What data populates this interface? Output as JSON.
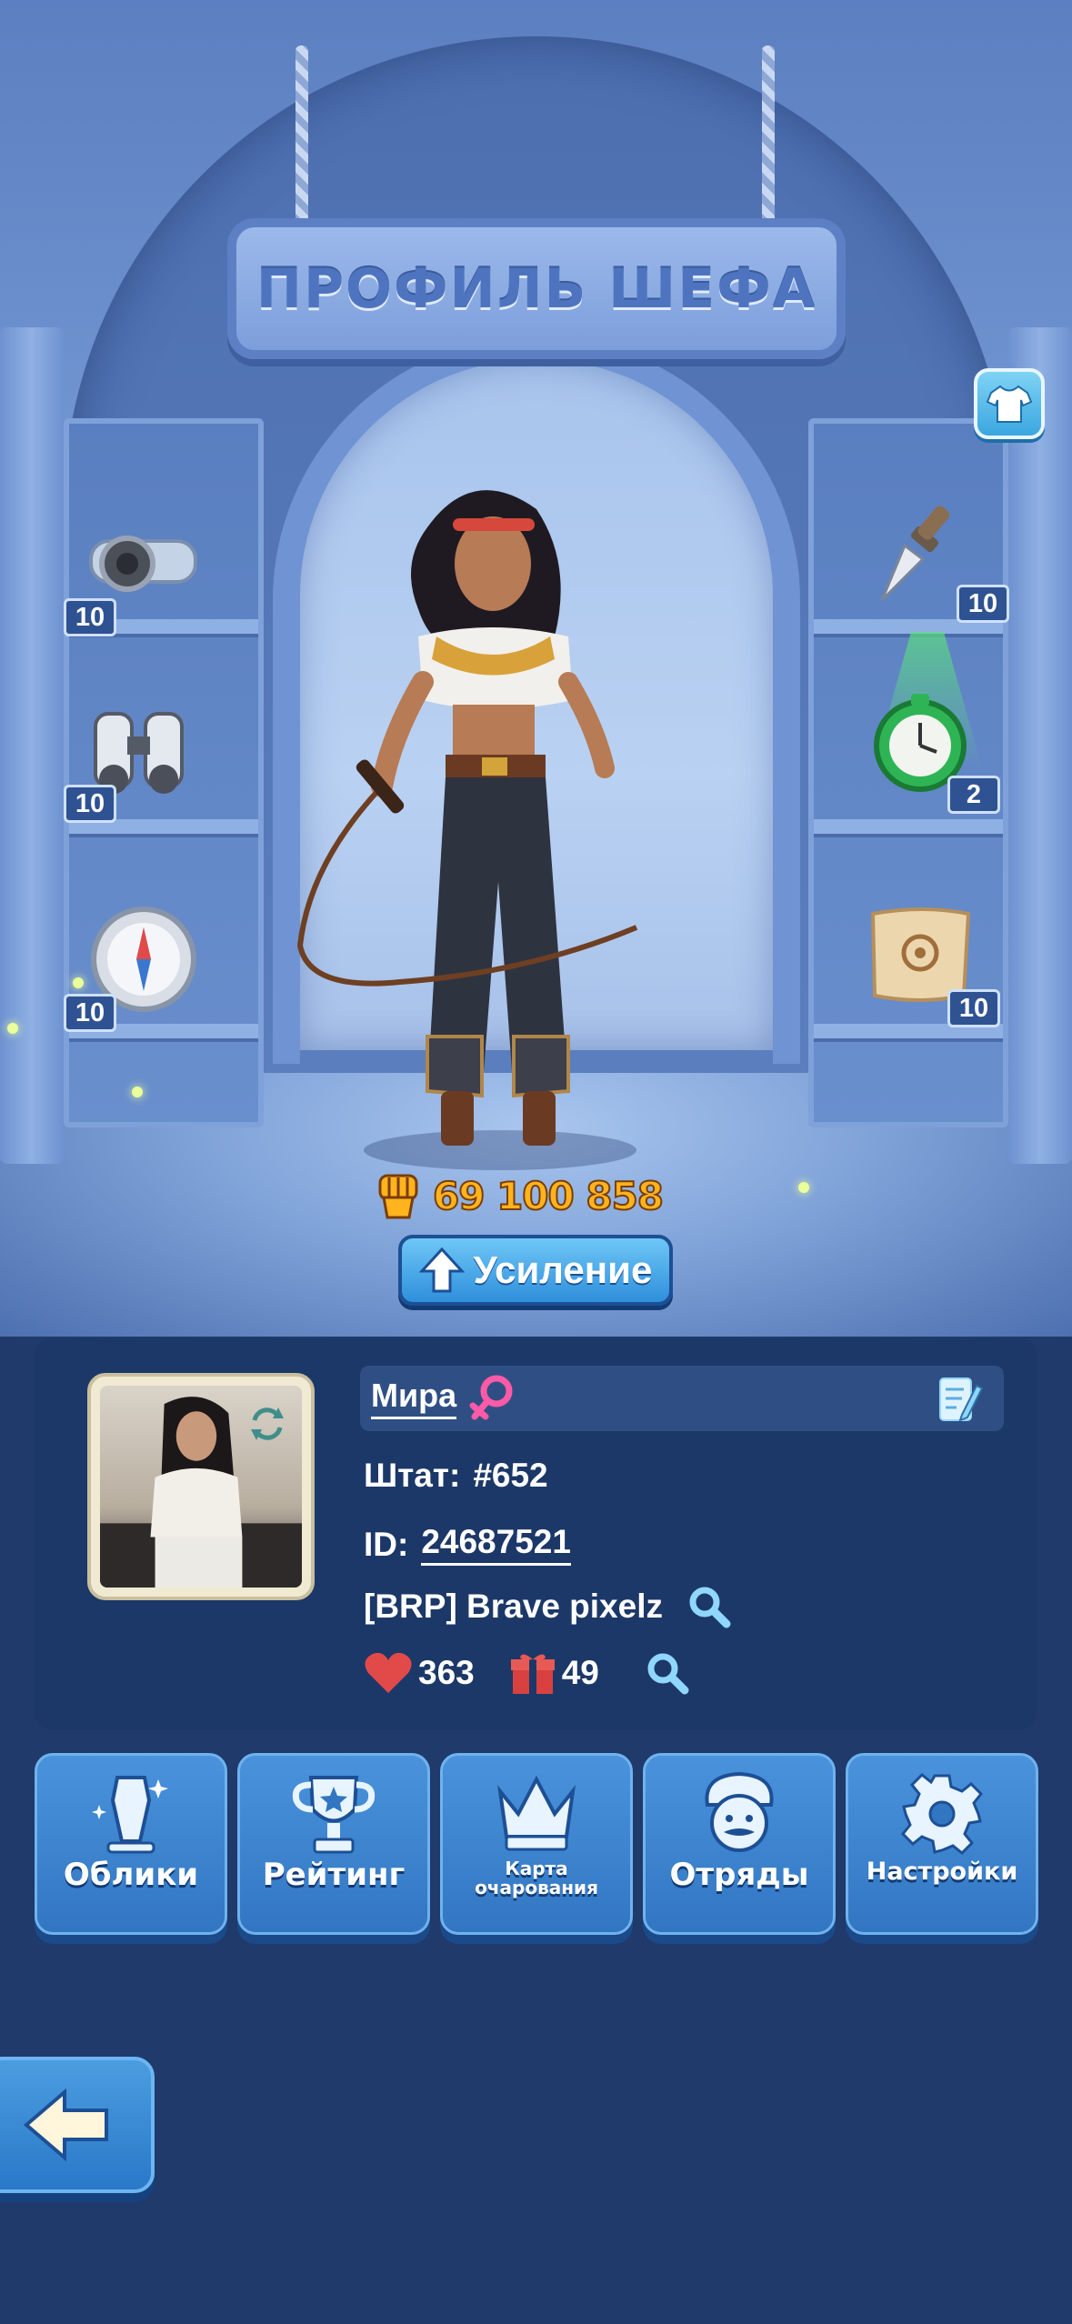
{
  "header": {
    "title": "ПРОФИЛЬ ШЕФА"
  },
  "items": {
    "left": [
      {
        "icon": "watch-strap-icon",
        "count": "10"
      },
      {
        "icon": "binoculars-icon",
        "count": "10"
      },
      {
        "icon": "compass-icon",
        "count": "10"
      }
    ],
    "right": [
      {
        "icon": "dagger-icon",
        "count": "10"
      },
      {
        "icon": "pocket-watch-icon",
        "count": "2"
      },
      {
        "icon": "map-scroll-icon",
        "count": "10"
      }
    ]
  },
  "character": {
    "power": "69 100 858",
    "boost_label": "Усиление"
  },
  "profile": {
    "name": "Мира",
    "state_label": "Штат:",
    "state_value": "#652",
    "id_label": "ID:",
    "id_value": "24687521",
    "clan": "[BRP] Brave pixelz",
    "likes": "363",
    "gifts": "49"
  },
  "menu": [
    {
      "label": "Облики",
      "icon": "costume-stand-icon"
    },
    {
      "label": "Рейтинг",
      "icon": "trophy-icon"
    },
    {
      "label": "Карта очарования",
      "icon": "crown-icon"
    },
    {
      "label": "Отряды",
      "icon": "chef-face-icon"
    },
    {
      "label": "Настройки",
      "icon": "gear-icon"
    }
  ],
  "colors": {
    "power": "#ffb31c",
    "panel": "#1c3868",
    "button": "#3276c2",
    "heart": "#e24a4a",
    "gift": "#d8413f",
    "search": "#8fd7ff"
  }
}
